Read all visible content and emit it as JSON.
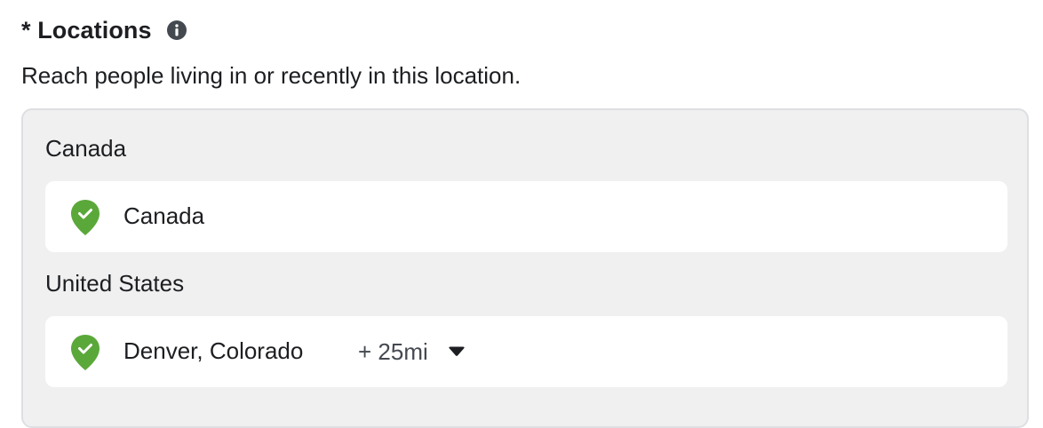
{
  "section": {
    "title": "* Locations",
    "subtitle": "Reach people living in or recently in this location."
  },
  "groups": [
    {
      "label": "Canada",
      "location": {
        "name": "Canada",
        "radius": ""
      }
    },
    {
      "label": "United States",
      "location": {
        "name": "Denver, Colorado",
        "radius": "+ 25mi"
      }
    }
  ],
  "icons": {
    "info": "info-circle-icon",
    "pin": "map-pin-check-icon",
    "caret": "caret-down-icon"
  },
  "colors": {
    "pin_green": "#5aa83a",
    "panel_bg": "#f0f0f0",
    "text": "#1c1e21"
  }
}
